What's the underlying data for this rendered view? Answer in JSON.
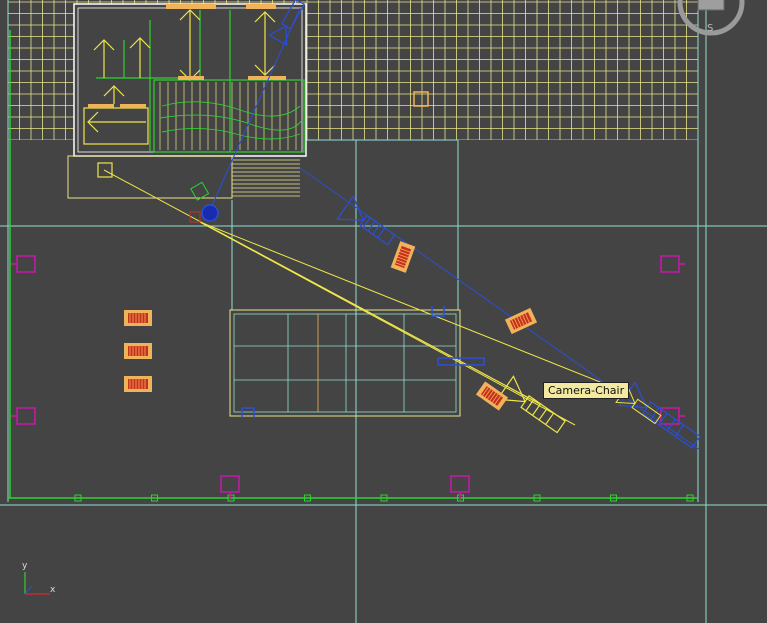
{
  "viewport": {
    "tooltip": "Camera-Chair",
    "viewcube": {
      "compass_letter": "S"
    },
    "axis_gizmo": {
      "y_label": "y",
      "x_label": "x"
    }
  },
  "colors": {
    "background": "#444444",
    "grid": "#e8e48a",
    "house_outline": "#ffffff",
    "ground_lines": "#8fe0d0",
    "selection_yellow": "#f0e64a",
    "camera_blue": "#2b4fd6",
    "light_magenta": "#c21aa6",
    "chair_orange": "#f0b25a",
    "chair_red": "#c8301e",
    "green_lines": "#2fd12f",
    "tooltip_bg": "#f3e9a0"
  },
  "icons": [
    "camera-target-icon",
    "camera-icon",
    "light-icon",
    "chair-icon",
    "viewcube-icon",
    "axis-gizmo-icon"
  ]
}
